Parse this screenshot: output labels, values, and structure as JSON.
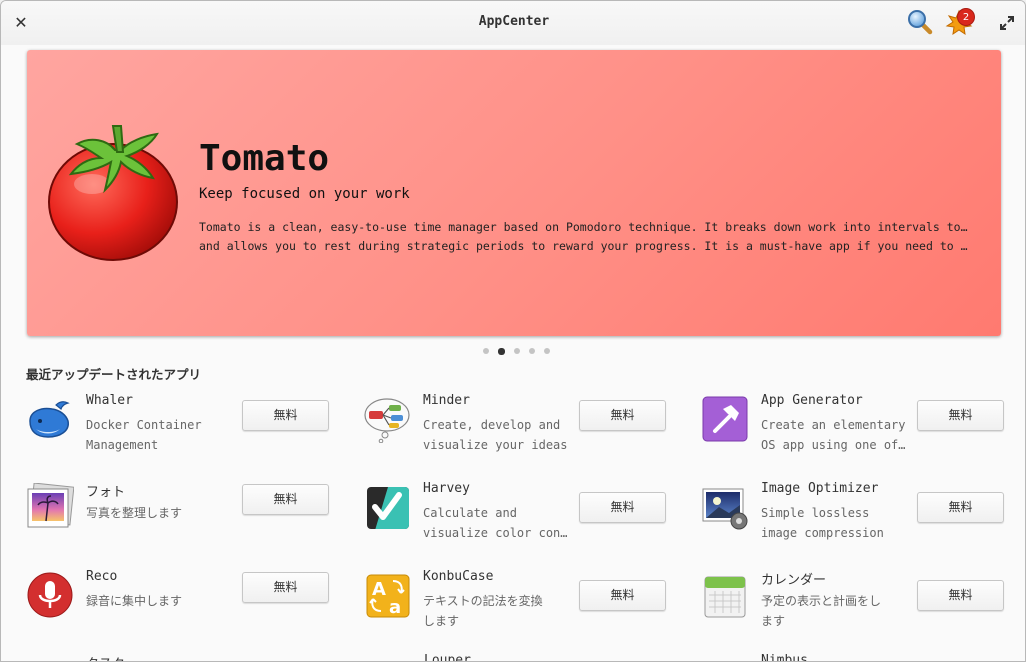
{
  "window": {
    "title": "AppCenter"
  },
  "header": {
    "update_count": "2"
  },
  "banner": {
    "name": "Tomato",
    "summary": "Keep focused on your work",
    "description_line1": "Tomato is a clean, easy-to-use time manager based on Pomodoro technique. It breaks down work into intervals to keep you focused",
    "description_line2": "and allows you to rest during strategic periods to reward your progress. It is a must-have app if you need to avoid procrastination.",
    "pages": 5,
    "active_page": 2,
    "background_color": "#ff8f86"
  },
  "section": {
    "title": "最近アップデートされたアプリ"
  },
  "apps": [
    {
      "name": "Whaler",
      "desc1": "Docker Container",
      "desc2": "Management",
      "button": "無料",
      "icon": "whale-icon"
    },
    {
      "name": "Minder",
      "desc1": "Create, develop and",
      "desc2": "visualize your ideas",
      "button": "無料",
      "icon": "mind-map-icon"
    },
    {
      "name": "App Generator",
      "desc1": "Create an elementary",
      "desc2": "OS app using one of the templates",
      "button": "無料",
      "icon": "hammer-icon"
    },
    {
      "name": "フォト",
      "desc1": "写真を整理します",
      "desc2": "",
      "button": "無料",
      "icon": "photos-icon"
    },
    {
      "name": "Harvey",
      "desc1": "Calculate and",
      "desc2": "visualize color contrast",
      "button": "無料",
      "icon": "check-icon"
    },
    {
      "name": "Image Optimizer",
      "desc1": "Simple lossless",
      "desc2": "image compression",
      "button": "無料",
      "icon": "image-gear-icon"
    },
    {
      "name": "Reco",
      "desc1": "録音に集中します",
      "desc2": "",
      "button": "無料",
      "icon": "microphone-icon"
    },
    {
      "name": "KonbuCase",
      "desc1": "テキストの記法を変換",
      "desc2": "します",
      "button": "無料",
      "icon": "text-case-icon"
    },
    {
      "name": "カレンダー",
      "desc1": "予定の表示と計画をし",
      "desc2": "ます",
      "button": "無料",
      "icon": "calendar-icon"
    }
  ],
  "partial_row": [
    "タスク",
    "Louper",
    "Nimbus"
  ]
}
